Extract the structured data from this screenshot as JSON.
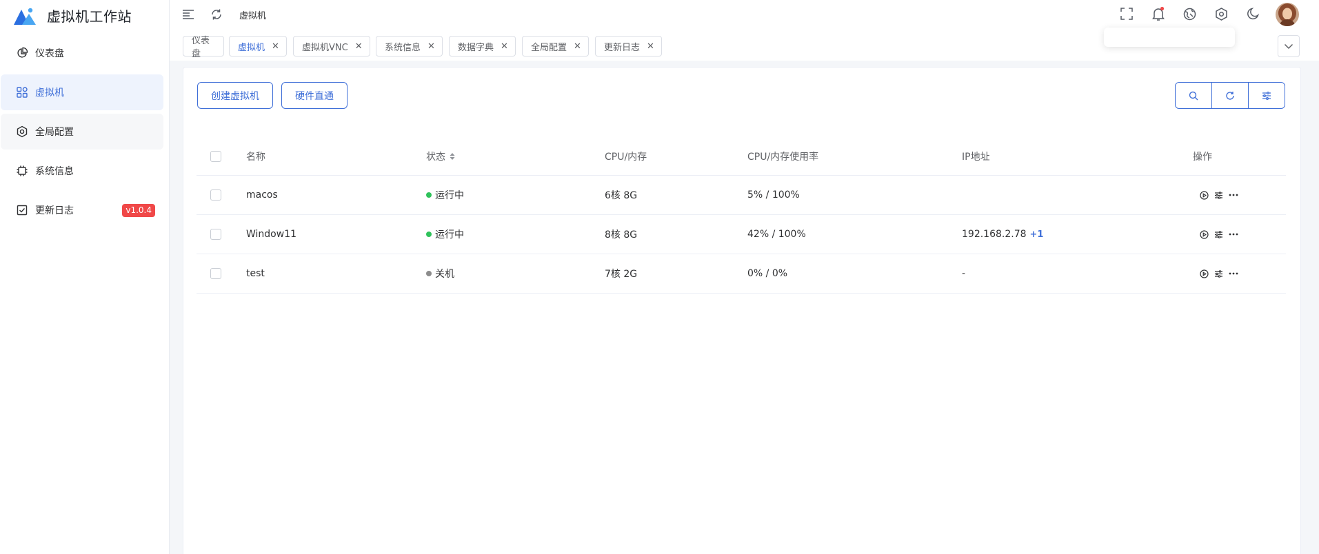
{
  "app": {
    "title": "虚拟机工作站",
    "accent_color": "#3f6fd8",
    "logo_icon": "mountain-logo-icon"
  },
  "sidebar": {
    "items": [
      {
        "label": "仪表盘",
        "icon": "pie-chart-icon",
        "active": false
      },
      {
        "label": "虚拟机",
        "icon": "grid-apps-icon",
        "active": true
      },
      {
        "label": "全局配置",
        "icon": "gear-icon",
        "active": false
      },
      {
        "label": "系统信息",
        "icon": "cpu-chip-icon",
        "active": false
      },
      {
        "label": "更新日志",
        "icon": "checklist-icon",
        "active": false,
        "badge": "v1.0.4"
      }
    ]
  },
  "header": {
    "breadcrumb": "虚拟机",
    "icons": [
      "menu-fold-icon",
      "refresh-icon",
      "fullscreen-icon",
      "bell-icon",
      "globe-icon",
      "settings-icon",
      "moon-icon",
      "avatar"
    ],
    "notification_dot_color": "#f04848"
  },
  "tabs": [
    {
      "label": "仪表盘",
      "closable": false,
      "active": false
    },
    {
      "label": "虚拟机",
      "closable": true,
      "active": true
    },
    {
      "label": "虚拟机VNC",
      "closable": true,
      "active": false
    },
    {
      "label": "系统信息",
      "closable": true,
      "active": false
    },
    {
      "label": "数据字典",
      "closable": true,
      "active": false
    },
    {
      "label": "全局配置",
      "closable": true,
      "active": false
    },
    {
      "label": "更新日志",
      "closable": true,
      "active": false
    }
  ],
  "toolbar": {
    "create_label": "创建虚拟机",
    "passthrough_label": "硬件直通",
    "right_icons": [
      "search-icon",
      "reload-icon",
      "column-settings-icon"
    ]
  },
  "table": {
    "columns": [
      "名称",
      "状态",
      "CPU/内存",
      "CPU/内存使用率",
      "IP地址",
      "操作"
    ],
    "rows": [
      {
        "name": "macos",
        "status": "运行中",
        "status_color": "#2fc25b",
        "cpu_mem": "6核 8G",
        "usage": "5% / 100%",
        "ip": "",
        "ip_more": ""
      },
      {
        "name": "Window11",
        "status": "运行中",
        "status_color": "#2fc25b",
        "cpu_mem": "8核 8G",
        "usage": "42% / 100%",
        "ip": "192.168.2.78",
        "ip_more": "+1"
      },
      {
        "name": "test",
        "status": "关机",
        "status_color": "#8c8c8c",
        "cpu_mem": "7核 2G",
        "usage": "0% / 0%",
        "ip": "-",
        "ip_more": ""
      }
    ],
    "row_actions": [
      "play-circle-icon",
      "sliders-icon",
      "more-dots-icon"
    ]
  },
  "colors": {
    "running": "#2fc25b",
    "stopped": "#8c8c8c",
    "badge": "#f04848"
  }
}
